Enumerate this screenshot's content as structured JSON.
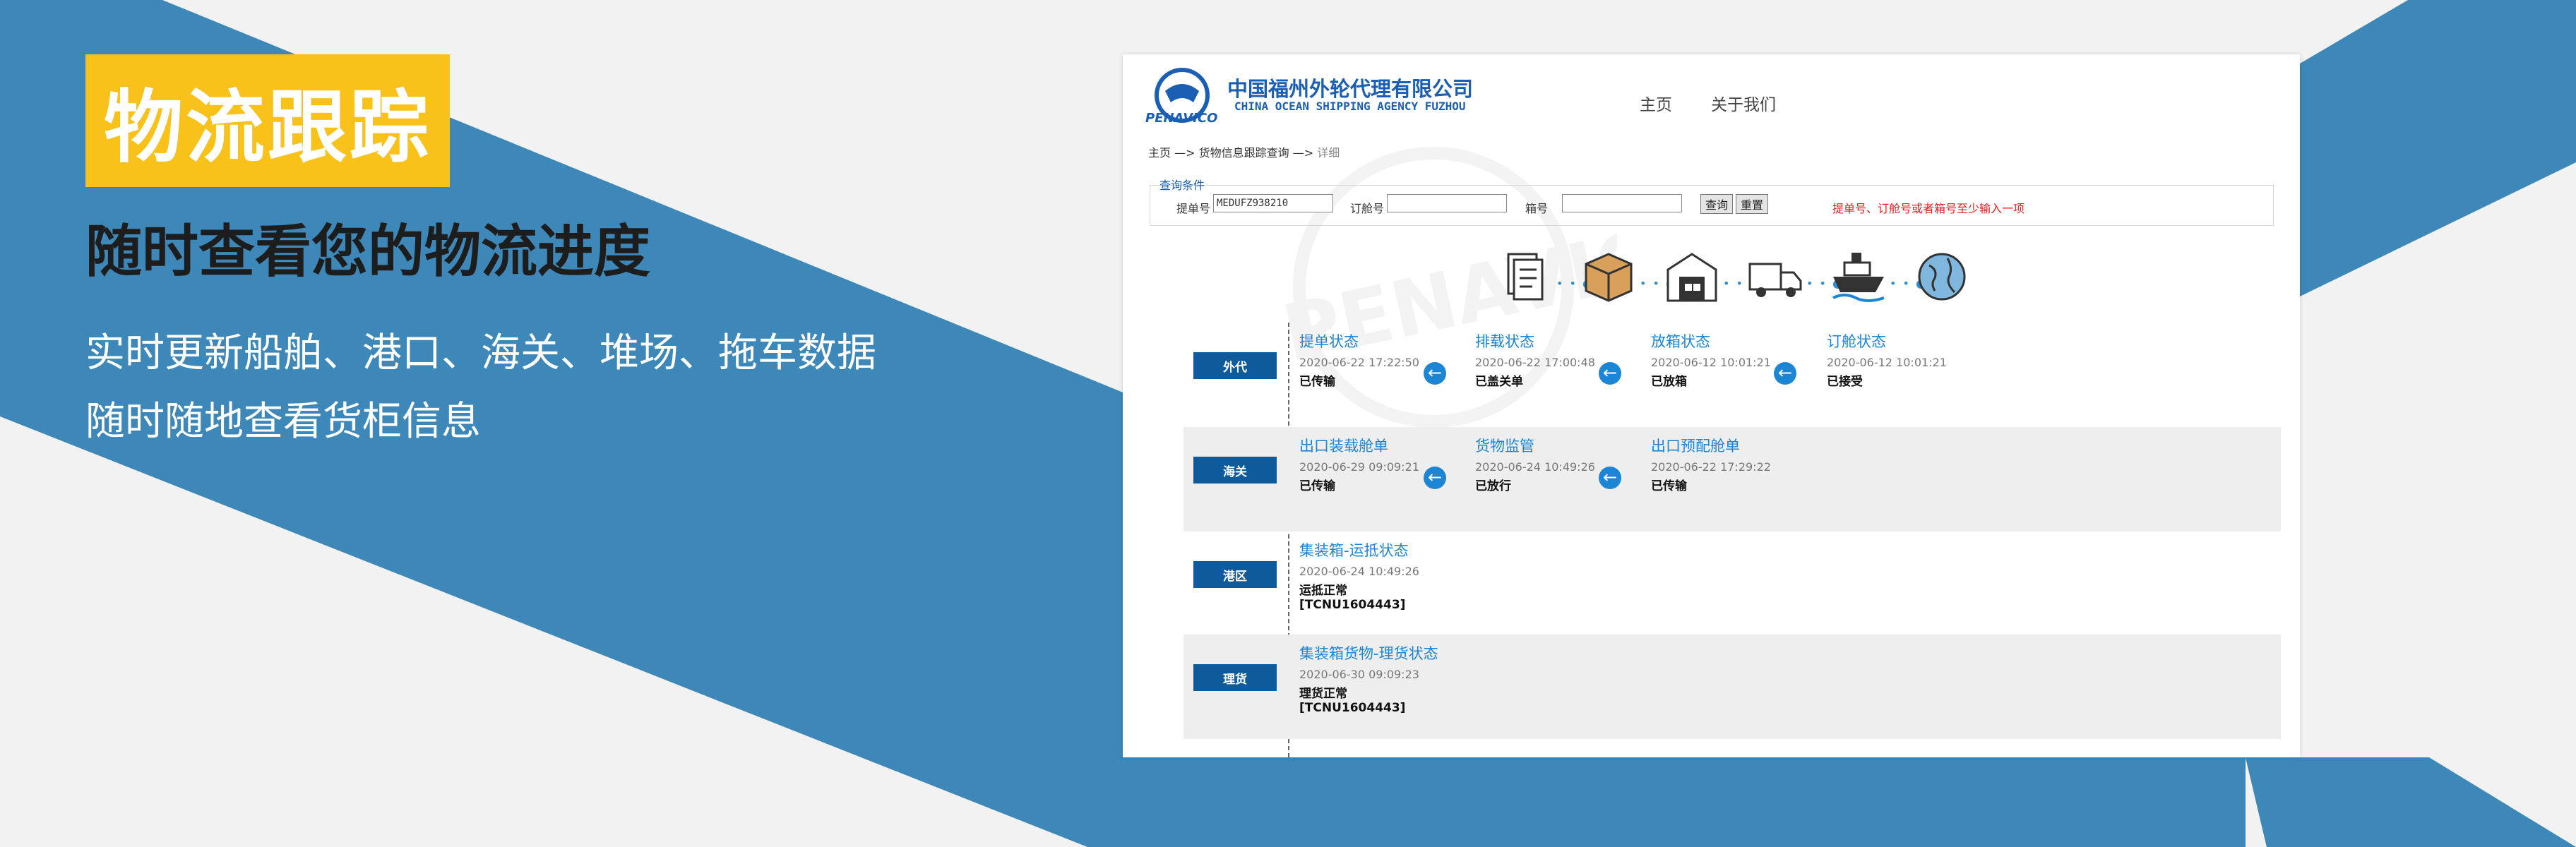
{
  "hero": {
    "badge": "物流跟踪",
    "subtitle": "随时查看您的物流进度",
    "line1": "实时更新船舶、港口、海关、堆场、拖车数据",
    "line2": "随时随地查看货柜信息"
  },
  "colors": {
    "accent_yellow": "#f9c21a",
    "band_blue": "#3d88b8",
    "brand_blue": "#1b5fb4",
    "label_navy": "#0e5a9a",
    "link_blue": "#1b85d6",
    "hint_red": "#e02020"
  },
  "site": {
    "logo_text": "PENAVICO",
    "company_cn": "中国福州外轮代理有限公司",
    "company_en": "CHINA OCEAN SHIPPING AGENCY FUZHOU",
    "nav": [
      "主页",
      "关于我们"
    ]
  },
  "breadcrumb": {
    "home": "主页",
    "sep": "—>",
    "section": "货物信息跟踪查询",
    "current": "详细"
  },
  "query": {
    "section_title": "查询条件",
    "bl_label": "提单号",
    "bl_value": "MEDUFZ938210",
    "booking_label": "订舱号",
    "booking_value": "",
    "container_label": "箱号",
    "container_value": "",
    "search_button": "查询",
    "reset_button": "重置",
    "hint": "提单号、订舱号或者箱号至少输入一项"
  },
  "flow_icons": [
    "document-icon",
    "package-icon",
    "warehouse-icon",
    "truck-icon",
    "ship-icon",
    "globe-icon"
  ],
  "rows": [
    {
      "category": "外代",
      "items": [
        {
          "title": "提单状态",
          "time": "2020-06-22 17:22:50",
          "status": "已传输",
          "note": ""
        },
        {
          "title": "排载状态",
          "time": "2020-06-22 17:00:48",
          "status": "已盖关单",
          "note": ""
        },
        {
          "title": "放箱状态",
          "time": "2020-06-12 10:01:21",
          "status": "已放箱",
          "note": ""
        },
        {
          "title": "订舱状态",
          "time": "2020-06-12 10:01:21",
          "status": "已接受",
          "note": ""
        }
      ]
    },
    {
      "category": "海关",
      "items": [
        {
          "title": "出口装载舱单",
          "time": "2020-06-29 09:09:21",
          "status": "已传输",
          "note": ""
        },
        {
          "title": "货物监管",
          "time": "2020-06-24 10:49:26",
          "status": "已放行",
          "note": ""
        },
        {
          "title": "出口预配舱单",
          "time": "2020-06-22 17:29:22",
          "status": "已传输",
          "note": ""
        }
      ]
    },
    {
      "category": "港区",
      "items": [
        {
          "title": "集装箱-运抵状态",
          "time": "2020-06-24 10:49:26",
          "status": "运抵正常",
          "note": "[TCNU1604443]"
        }
      ]
    },
    {
      "category": "理货",
      "items": [
        {
          "title": "集装箱货物-理货状态",
          "time": "2020-06-30 09:09:23",
          "status": "理货正常",
          "note": "[TCNU1604443]"
        }
      ]
    }
  ]
}
